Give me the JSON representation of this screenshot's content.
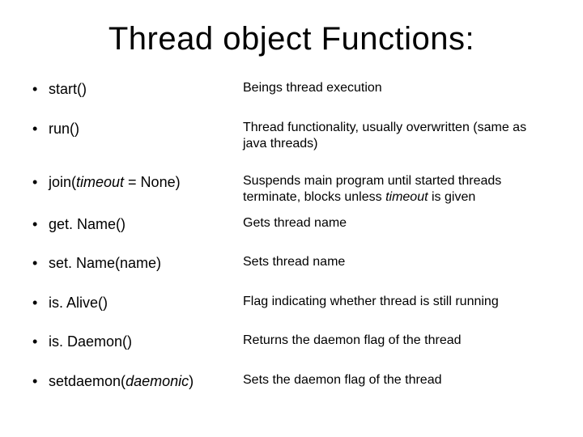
{
  "title": "Thread object Functions:",
  "items": [
    {
      "fn_html": "start()",
      "desc_html": "Beings thread execution"
    },
    {
      "fn_html": "run()",
      "desc_html": "Thread functionality, usually overwritten (same as java threads)"
    },
    {
      "fn_html": "join(<i>timeout</i> = None)",
      "desc_html": "Suspends main program until started threads terminate, blocks unless <i>timeout</i> is given"
    },
    {
      "fn_html": "get. Name()",
      "desc_html": "Gets thread name",
      "tight": true
    },
    {
      "fn_html": "set. Name(name)",
      "desc_html": "Sets thread name"
    },
    {
      "fn_html": "is. Alive()",
      "desc_html": "Flag indicating whether thread is still running"
    },
    {
      "fn_html": "is. Daemon()",
      "desc_html": "Returns the daemon flag of the thread"
    },
    {
      "fn_html": "setdaemon(<i>daemonic</i>)",
      "desc_html": "Sets the daemon flag of the thread"
    }
  ]
}
